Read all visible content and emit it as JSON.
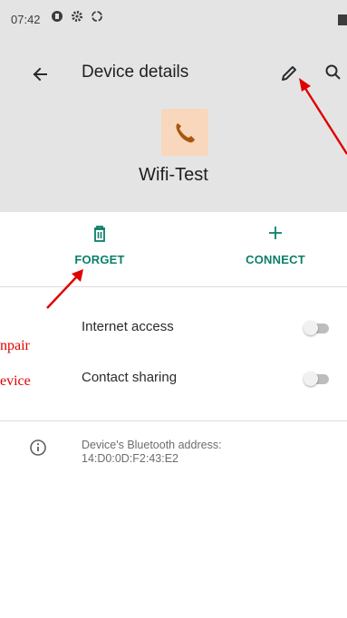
{
  "status_bar": {
    "time": "07:42",
    "icons": [
      "notification-circle-icon",
      "settings-gear-icon",
      "sync-icon"
    ]
  },
  "toolbar": {
    "title": "Device details",
    "back_icon": "arrow-back-icon",
    "edit_icon": "pencil-icon",
    "search_icon": "search-icon"
  },
  "device": {
    "name": "Wifi-Test",
    "icon": "phone-icon"
  },
  "actions": {
    "forget_label": "FORGET",
    "connect_label": "CONNECT"
  },
  "settings": [
    {
      "label": "Internet access",
      "enabled": false
    },
    {
      "label": "Contact sharing",
      "enabled": false
    }
  ],
  "info": {
    "line1": "Device's Bluetooth address:",
    "line2": "14:D0:0D:F2:43:E2"
  },
  "annotations": {
    "text1": "npair",
    "text2": "evice"
  },
  "colors": {
    "header_bg": "#e4e4e4",
    "accent": "#0a7f68",
    "device_icon_bg": "#f8d7bd",
    "device_icon_fg": "#a9570c",
    "annotation": "#e00000"
  }
}
